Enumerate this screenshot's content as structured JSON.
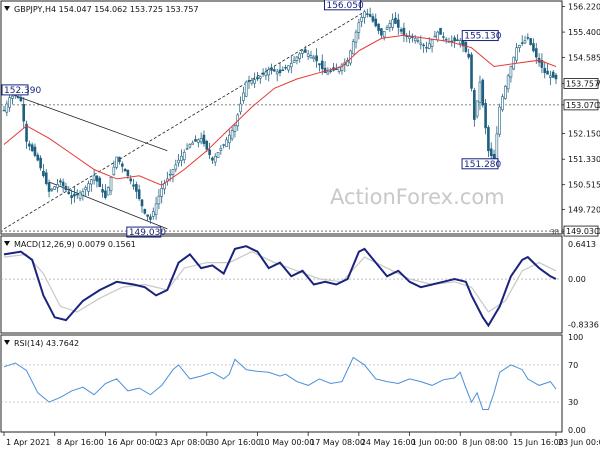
{
  "chart_data": [
    {
      "type": "candlestick",
      "legend": "GBPJPY,H4  154.047 154.062 153.725 153.757",
      "symbol_icon": "triangle-down-icon",
      "watermark": "ActionForex.com",
      "ylim": [
        149.0,
        156.3
      ],
      "y_ticks": [
        "156.220",
        "155.400",
        "154.585",
        "153.757",
        "153.070",
        "152.150",
        "151.330",
        "150.515",
        "149.720",
        "149.030"
      ],
      "current_price": "153.757",
      "horizontal_levels": [
        {
          "label": "153.070",
          "value": 153.07
        },
        {
          "label": "149.030",
          "value": 149.03
        }
      ],
      "fib_label": "38.2",
      "annotations": [
        {
          "label": "152.390",
          "value": 153.39
        },
        {
          "label": "149.030",
          "value": 149.03
        },
        {
          "label": "156.050",
          "value": 156.05
        },
        {
          "label": "155.130",
          "value": 155.13
        },
        {
          "label": "151.280",
          "value": 151.28
        }
      ],
      "price_path": [
        [
          0,
          152.9
        ],
        [
          2,
          153.3
        ],
        [
          4,
          153.4
        ],
        [
          6,
          153.2
        ],
        [
          8,
          151.9
        ],
        [
          12,
          151.3
        ],
        [
          16,
          150.3
        ],
        [
          20,
          150.6
        ],
        [
          24,
          150.1
        ],
        [
          28,
          150.3
        ],
        [
          32,
          150.8
        ],
        [
          36,
          150.1
        ],
        [
          40,
          151.4
        ],
        [
          44,
          150.8
        ],
        [
          47,
          150.3
        ],
        [
          50,
          149.6
        ],
        [
          52,
          149.4
        ],
        [
          56,
          150.4
        ],
        [
          62,
          151.3
        ],
        [
          66,
          151.8
        ],
        [
          70,
          152.0
        ],
        [
          74,
          151.3
        ],
        [
          78,
          151.8
        ],
        [
          82,
          152.4
        ],
        [
          86,
          153.8
        ],
        [
          90,
          153.9
        ],
        [
          94,
          154.2
        ],
        [
          98,
          154.1
        ],
        [
          102,
          154.4
        ],
        [
          106,
          154.8
        ],
        [
          110,
          154.6
        ],
        [
          114,
          154.1
        ],
        [
          118,
          154.2
        ],
        [
          122,
          154.5
        ],
        [
          126,
          155.7
        ],
        [
          128,
          156.05
        ],
        [
          130,
          155.9
        ],
        [
          134,
          155.3
        ],
        [
          138,
          155.8
        ],
        [
          142,
          155.3
        ],
        [
          146,
          155.2
        ],
        [
          150,
          154.9
        ],
        [
          154,
          155.4
        ],
        [
          158,
          155.1
        ],
        [
          162,
          155.13
        ],
        [
          165,
          154.6
        ],
        [
          167,
          152.6
        ],
        [
          169,
          153.8
        ],
        [
          172,
          151.6
        ],
        [
          174,
          151.28
        ],
        [
          176,
          153.0
        ],
        [
          179,
          154.0
        ],
        [
          182,
          154.9
        ],
        [
          186,
          155.2
        ],
        [
          189,
          154.6
        ],
        [
          192,
          154.1
        ],
        [
          196,
          153.9
        ]
      ],
      "sma_path": [
        [
          0,
          151.8
        ],
        [
          8,
          152.4
        ],
        [
          16,
          152.0
        ],
        [
          24,
          151.5
        ],
        [
          32,
          151.0
        ],
        [
          40,
          150.7
        ],
        [
          48,
          150.8
        ],
        [
          56,
          150.5
        ],
        [
          64,
          151.0
        ],
        [
          72,
          151.6
        ],
        [
          80,
          152.3
        ],
        [
          88,
          153.0
        ],
        [
          96,
          153.6
        ],
        [
          104,
          153.9
        ],
        [
          112,
          154.1
        ],
        [
          120,
          154.3
        ],
        [
          126,
          154.8
        ],
        [
          134,
          155.2
        ],
        [
          142,
          155.3
        ],
        [
          150,
          155.2
        ],
        [
          158,
          155.1
        ],
        [
          166,
          154.9
        ],
        [
          174,
          154.3
        ],
        [
          182,
          154.4
        ],
        [
          190,
          154.5
        ],
        [
          196,
          154.3
        ]
      ],
      "trendlines": [
        {
          "from": [
            0,
            153.5
          ],
          "to": [
            58,
            151.6
          ]
        },
        {
          "from": [
            16,
            150.6
          ],
          "to": [
            58,
            149.1
          ]
        },
        {
          "from": [
            0,
            149.1
          ],
          "to": [
            128,
            156.05
          ]
        }
      ],
      "colors": {
        "candles": "#1e5e7e",
        "sma": "#e53935",
        "annotation": "#1a237e"
      }
    },
    {
      "type": "line",
      "legend": "MACD(12,26,9) 0.0079 0.1561",
      "ylim": [
        -0.95,
        0.75
      ],
      "y_ticks": [
        "0.6413",
        "0.00",
        "-0.8336"
      ],
      "macd": [
        [
          0,
          0.45
        ],
        [
          6,
          0.5
        ],
        [
          10,
          0.35
        ],
        [
          14,
          -0.3
        ],
        [
          18,
          -0.7
        ],
        [
          22,
          -0.75
        ],
        [
          28,
          -0.4
        ],
        [
          34,
          -0.2
        ],
        [
          40,
          -0.05
        ],
        [
          46,
          -0.1
        ],
        [
          50,
          -0.15
        ],
        [
          54,
          -0.3
        ],
        [
          58,
          -0.2
        ],
        [
          62,
          0.3
        ],
        [
          66,
          0.45
        ],
        [
          70,
          0.2
        ],
        [
          74,
          0.25
        ],
        [
          78,
          0.1
        ],
        [
          82,
          0.55
        ],
        [
          86,
          0.6
        ],
        [
          90,
          0.5
        ],
        [
          94,
          0.2
        ],
        [
          98,
          0.3
        ],
        [
          102,
          0.05
        ],
        [
          106,
          0.15
        ],
        [
          110,
          -0.1
        ],
        [
          114,
          -0.05
        ],
        [
          118,
          -0.1
        ],
        [
          122,
          0.0
        ],
        [
          126,
          0.5
        ],
        [
          128,
          0.55
        ],
        [
          132,
          0.3
        ],
        [
          136,
          0.05
        ],
        [
          140,
          0.15
        ],
        [
          144,
          -0.05
        ],
        [
          148,
          -0.15
        ],
        [
          152,
          -0.1
        ],
        [
          156,
          -0.05
        ],
        [
          160,
          0.0
        ],
        [
          164,
          -0.05
        ],
        [
          166,
          -0.3
        ],
        [
          170,
          -0.7
        ],
        [
          172,
          -0.85
        ],
        [
          176,
          -0.5
        ],
        [
          180,
          0.05
        ],
        [
          184,
          0.35
        ],
        [
          186,
          0.4
        ],
        [
          190,
          0.2
        ],
        [
          194,
          0.05
        ],
        [
          196,
          0.0
        ]
      ],
      "signal": [
        [
          0,
          0.4
        ],
        [
          8,
          0.45
        ],
        [
          14,
          0.1
        ],
        [
          20,
          -0.5
        ],
        [
          26,
          -0.6
        ],
        [
          34,
          -0.35
        ],
        [
          42,
          -0.15
        ],
        [
          50,
          -0.1
        ],
        [
          58,
          -0.2
        ],
        [
          64,
          0.2
        ],
        [
          72,
          0.3
        ],
        [
          80,
          0.3
        ],
        [
          88,
          0.5
        ],
        [
          96,
          0.3
        ],
        [
          104,
          0.15
        ],
        [
          112,
          0.0
        ],
        [
          120,
          -0.05
        ],
        [
          128,
          0.4
        ],
        [
          136,
          0.2
        ],
        [
          144,
          0.0
        ],
        [
          152,
          -0.1
        ],
        [
          160,
          -0.05
        ],
        [
          166,
          -0.15
        ],
        [
          172,
          -0.6
        ],
        [
          178,
          -0.4
        ],
        [
          184,
          0.15
        ],
        [
          190,
          0.3
        ],
        [
          196,
          0.15
        ]
      ],
      "colors": {
        "macd": "#1a237e",
        "signal": "#c8c8c8"
      }
    },
    {
      "type": "line",
      "legend": "RSI(14) 43.7642",
      "ylim": [
        0,
        100
      ],
      "y_ticks": [
        "100",
        "70",
        "30",
        "0.00"
      ],
      "levels": [
        70,
        30
      ],
      "rsi": [
        [
          0,
          68
        ],
        [
          4,
          72
        ],
        [
          8,
          64
        ],
        [
          12,
          40
        ],
        [
          16,
          30
        ],
        [
          20,
          35
        ],
        [
          24,
          42
        ],
        [
          28,
          46
        ],
        [
          32,
          38
        ],
        [
          36,
          50
        ],
        [
          40,
          55
        ],
        [
          44,
          42
        ],
        [
          48,
          45
        ],
        [
          52,
          38
        ],
        [
          56,
          48
        ],
        [
          60,
          65
        ],
        [
          62,
          70
        ],
        [
          66,
          55
        ],
        [
          70,
          58
        ],
        [
          74,
          62
        ],
        [
          78,
          55
        ],
        [
          80,
          60
        ],
        [
          82,
          76
        ],
        [
          86,
          65
        ],
        [
          90,
          63
        ],
        [
          94,
          62
        ],
        [
          98,
          58
        ],
        [
          100,
          60
        ],
        [
          104,
          52
        ],
        [
          108,
          48
        ],
        [
          112,
          55
        ],
        [
          116,
          50
        ],
        [
          120,
          52
        ],
        [
          124,
          78
        ],
        [
          126,
          74
        ],
        [
          128,
          70
        ],
        [
          132,
          55
        ],
        [
          136,
          52
        ],
        [
          140,
          50
        ],
        [
          144,
          55
        ],
        [
          148,
          52
        ],
        [
          152,
          48
        ],
        [
          156,
          54
        ],
        [
          160,
          56
        ],
        [
          162,
          62
        ],
        [
          164,
          45
        ],
        [
          166,
          30
        ],
        [
          168,
          40
        ],
        [
          170,
          22
        ],
        [
          172,
          22
        ],
        [
          174,
          40
        ],
        [
          176,
          62
        ],
        [
          180,
          70
        ],
        [
          184,
          65
        ],
        [
          186,
          55
        ],
        [
          190,
          48
        ],
        [
          194,
          52
        ],
        [
          196,
          44
        ]
      ],
      "colors": {
        "rsi": "#4a90d9",
        "level": "#aaaaaa"
      }
    }
  ],
  "x_axis": {
    "labels": [
      "1 Apr 2021",
      "8 Apr 16:00",
      "16 Apr 00:00",
      "23 Apr 08:00",
      "30 Apr 16:00",
      "10 May 00:00",
      "17 May 08:00",
      "24 May 16:00",
      "1 Jun 00:00",
      "8 Jun 08:00",
      "15 Jun 16:00",
      "23 Jun 00:00"
    ],
    "positions": [
      0,
      18,
      36,
      54,
      72,
      90,
      108,
      126,
      144,
      162,
      180,
      196
    ]
  }
}
